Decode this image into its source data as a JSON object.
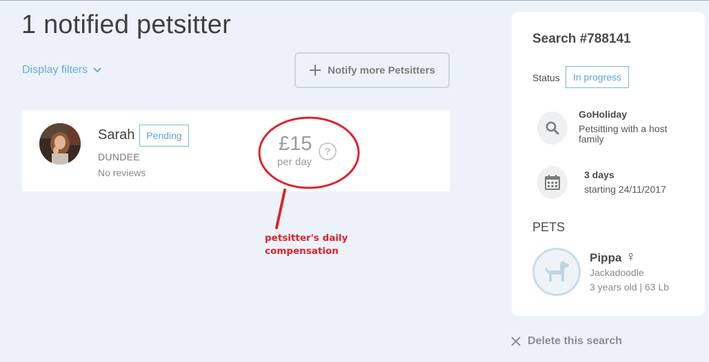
{
  "header": {
    "title": "1 notified petsitter",
    "display_filters_label": "Display filters",
    "notify_button_label": "Notify more Petsitters"
  },
  "petsitter": {
    "name": "Sarah",
    "status": "Pending",
    "city": "DUNDEE",
    "reviews": "No reviews",
    "price": "£15",
    "price_unit": "per day",
    "help_glyph": "?"
  },
  "annotation": {
    "text": "petsitter's daily compensation",
    "color": "#e0202a"
  },
  "search": {
    "title": "Search #788141",
    "status_label": "Status",
    "status_value": "In progress",
    "service_name": "GoHoliday",
    "service_description": "Petsitting with a host family",
    "duration": "3 days",
    "start": "starting 24/11/2017",
    "pets_heading": "PETS"
  },
  "pet": {
    "name": "Pippa",
    "gender_symbol": "♀",
    "breed": "Jackadoodle",
    "details": "3 years old | 63 Lb"
  },
  "actions": {
    "delete_label": "Delete this search"
  },
  "colors": {
    "background": "#edf2fa",
    "accent_blue": "#5fa2d4",
    "annotation_red": "#e0202a"
  },
  "icons": [
    "chevron-down-icon",
    "plus-icon",
    "help-icon",
    "search-icon",
    "calendar-icon",
    "dog-icon",
    "close-icon"
  ]
}
